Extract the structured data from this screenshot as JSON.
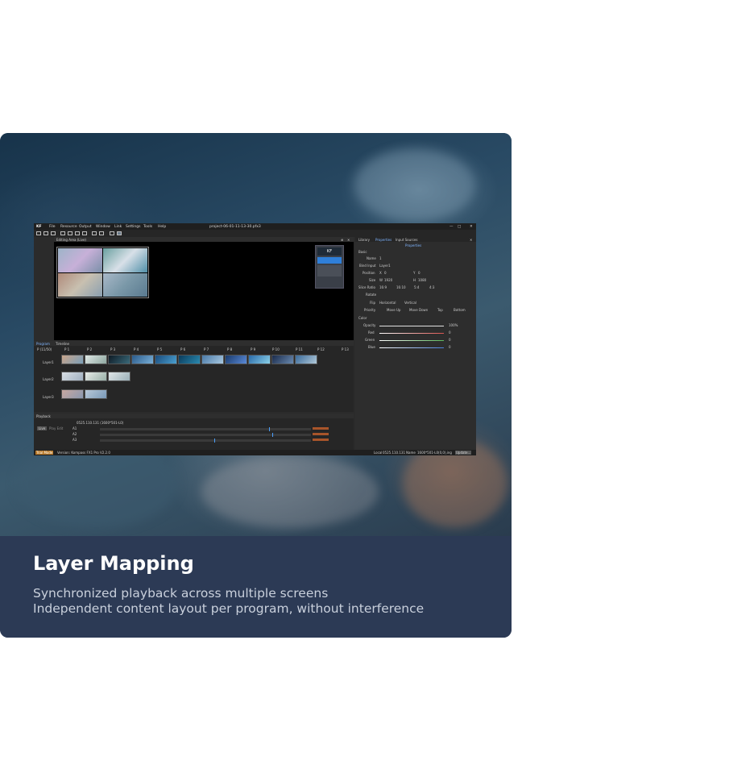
{
  "card": {
    "title": "Layer Mapping",
    "desc_line1": "Synchronized playback across multiple screens",
    "desc_line2": "Independent content layout per program, without interference"
  },
  "app": {
    "menu": [
      "File",
      "Resource",
      "Output",
      "Window",
      "Link",
      "Settings",
      "Tools",
      "Help"
    ],
    "window_title": "project-06-01-11-13-30.pfx3",
    "editing_area_title": "Editing Area (Live)",
    "side_tabs": [
      "Library",
      "Properties",
      "Input Sources"
    ],
    "properties_header": "Properties",
    "basic_section": "Basic",
    "props": {
      "name_label": "Name",
      "name_value": "1",
      "bind_label": "Bind Input",
      "bind_value": "Layer1",
      "position_label": "Position",
      "x_label": "X",
      "x_value": "0",
      "y_label": "Y",
      "y_value": "0",
      "size_label": "Size",
      "w_label": "W",
      "w_value": "1920",
      "h_label": "H",
      "h_value": "1080",
      "ratio_label": "Slice Ratio",
      "ratios": [
        "16:9",
        "16:10",
        "5:4",
        "4:3"
      ],
      "rotate_label": "Rotate",
      "flip_label": "Flip",
      "flip_h": "Horizontal",
      "flip_v": "Vertical",
      "priority_label": "Priority",
      "priority_opts": [
        "Move Up",
        "Move Down",
        "Top",
        "Bottom"
      ]
    },
    "color_section": "Color",
    "colors": [
      {
        "label": "Opacity",
        "value": "100%",
        "color": "#e0e0e0"
      },
      {
        "label": "Red",
        "value": "0",
        "color": "#d9534f"
      },
      {
        "label": "Green",
        "value": "0",
        "color": "#5cb85c"
      },
      {
        "label": "Blue",
        "value": "0",
        "color": "#4a7fd9"
      }
    ],
    "program_tabs": [
      "Program",
      "Timeline"
    ],
    "program_counter": "P (11/50)",
    "programs": [
      "P 1",
      "P 2",
      "P 3",
      "P 4",
      "P 5",
      "P 6",
      "P 7",
      "P 8",
      "P 9",
      "P 10",
      "P 11",
      "P 12",
      "P 13"
    ],
    "layers": [
      "Layer1",
      "Layer2",
      "Layer3"
    ],
    "playback_title": "Playback",
    "playback_buttons": [
      "Live",
      "Play Edit"
    ],
    "playback_group": "0525.110.131 (1600*501-L0)",
    "tracks": [
      "A1",
      "A2",
      "A3"
    ],
    "status_left": "Trial Mode",
    "status_version": "Version: Kompass FX1 Pro V2.2.0",
    "status_local": "Local",
    "status_ip": "0525.110.131",
    "status_name_label": "Name",
    "status_name": "1600*501-L0(0,0),ing",
    "status_update": "Update..."
  }
}
